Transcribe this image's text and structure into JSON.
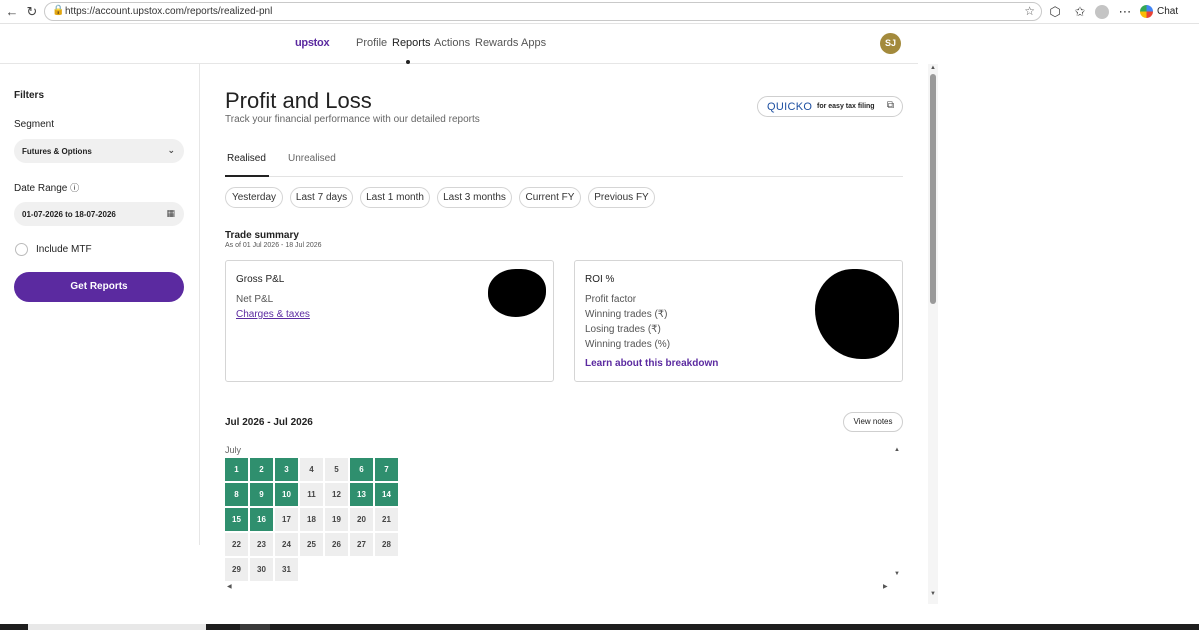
{
  "browser": {
    "url": "https://account.upstox.com/reports/realized-pnl",
    "chat_label": "Chat"
  },
  "header": {
    "logo": "upstox",
    "nav": [
      "Profile",
      "Reports",
      "Actions",
      "Rewards",
      "Apps"
    ],
    "active_nav": "Reports",
    "avatar_initials": "SJ"
  },
  "sidebar": {
    "filters_title": "Filters",
    "segment_label": "Segment",
    "segment_value": "Futures & Options",
    "date_range_label": "Date Range",
    "date_range_value": "01-07-2026 to 18-07-2026",
    "include_mtf_label": "Include MTF",
    "include_mtf_checked": false,
    "get_reports_label": "Get Reports"
  },
  "main": {
    "title": "Profit and Loss",
    "subtitle": "Track your financial performance with our detailed reports",
    "quicko_brand": "QUICKO",
    "quicko_tagline": "for easy tax filing",
    "tabs": [
      "Realised",
      "Unrealised"
    ],
    "active_tab": "Realised",
    "filter_chips": [
      "Yesterday",
      "Last 7 days",
      "Last 1 month",
      "Last 3 months",
      "Current FY",
      "Previous FY"
    ],
    "trade_summary_title": "Trade summary",
    "trade_summary_subtitle": "As of 01 Jul 2026 - 18 Jul 2026",
    "left_card": {
      "heading": "Gross P&L",
      "rows": [
        "Net P&L"
      ],
      "link": "Charges & taxes"
    },
    "right_card": {
      "heading": "ROI %",
      "rows": [
        "Profit factor",
        "Winning trades (₹)",
        "Losing trades (₹)",
        "Winning trades (%)"
      ],
      "link": "Learn about this breakdown"
    },
    "period_title": "Jul 2026 - Jul 2026",
    "view_notes_label": "View notes",
    "month_label": "July",
    "calendar_days": [
      {
        "d": "1",
        "profit": true
      },
      {
        "d": "2",
        "profit": true
      },
      {
        "d": "3",
        "profit": true
      },
      {
        "d": "4",
        "profit": false
      },
      {
        "d": "5",
        "profit": false
      },
      {
        "d": "6",
        "profit": true
      },
      {
        "d": "7",
        "profit": true
      },
      {
        "d": "8",
        "profit": true
      },
      {
        "d": "9",
        "profit": true
      },
      {
        "d": "10",
        "profit": true
      },
      {
        "d": "11",
        "profit": false
      },
      {
        "d": "12",
        "profit": false
      },
      {
        "d": "13",
        "profit": true
      },
      {
        "d": "14",
        "profit": true
      },
      {
        "d": "15",
        "profit": true
      },
      {
        "d": "16",
        "profit": true
      },
      {
        "d": "17",
        "profit": false
      },
      {
        "d": "18",
        "profit": false
      },
      {
        "d": "19",
        "profit": false
      },
      {
        "d": "20",
        "profit": false
      },
      {
        "d": "21",
        "profit": false
      },
      {
        "d": "22",
        "profit": false
      },
      {
        "d": "23",
        "profit": false
      },
      {
        "d": "24",
        "profit": false
      },
      {
        "d": "25",
        "profit": false
      },
      {
        "d": "26",
        "profit": false
      },
      {
        "d": "27",
        "profit": false
      },
      {
        "d": "28",
        "profit": false
      },
      {
        "d": "29",
        "profit": false
      },
      {
        "d": "30",
        "profit": false
      },
      {
        "d": "31",
        "profit": false
      }
    ]
  },
  "colors": {
    "brand_purple": "#5b2aa0",
    "profit_green": "#2f8f6e",
    "neutral_day": "#eeeeee"
  }
}
